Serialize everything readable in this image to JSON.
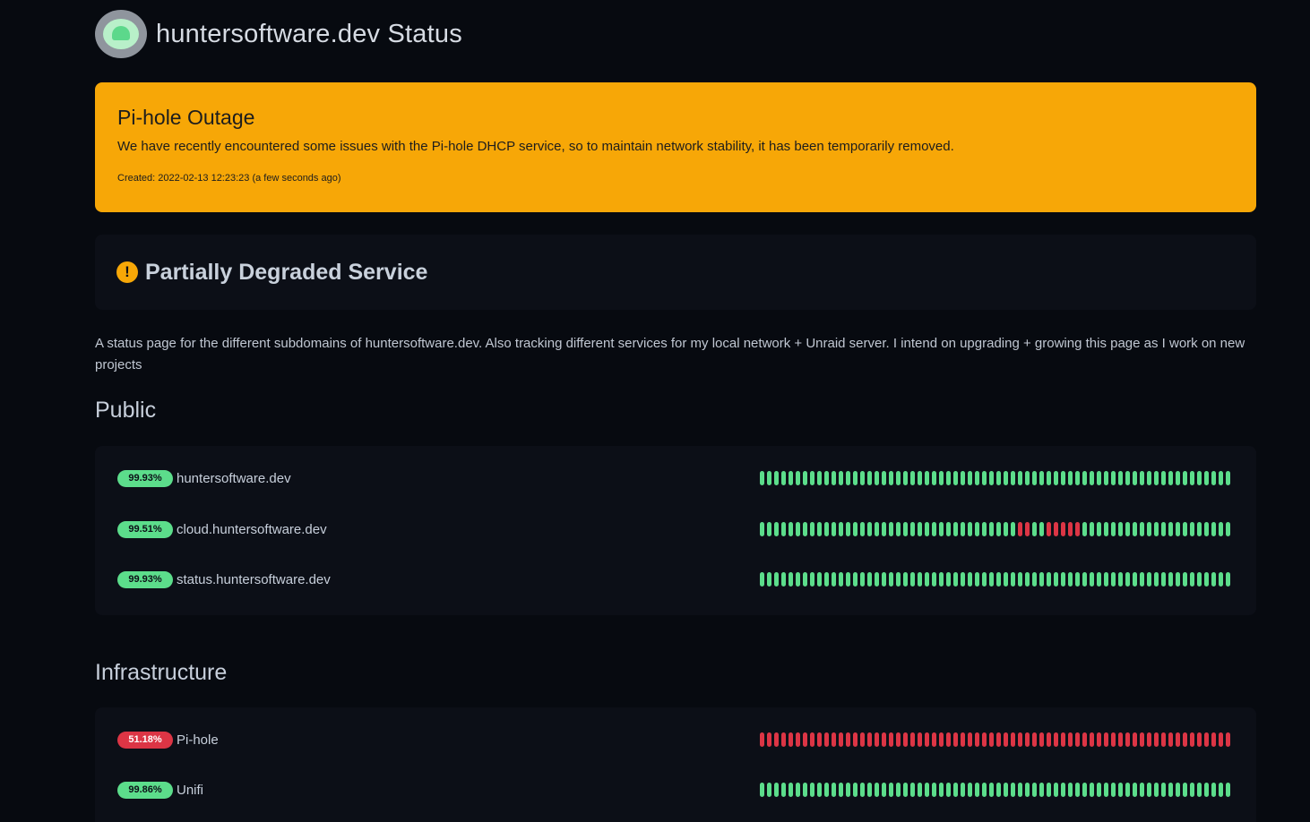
{
  "header": {
    "title": "huntersoftware.dev Status",
    "logo_icon": "status-logo-icon"
  },
  "incident": {
    "title": "Pi-hole Outage",
    "body": "We have recently encountered some issues with the Pi-hole DHCP service, so to maintain network stability, it has been temporarily removed.",
    "created": "Created: 2022-02-13 12:23:23 (a few seconds ago)",
    "color": "#f7a707"
  },
  "overall": {
    "icon": "exclamation-circle-icon",
    "text": "Partially Degraded Service"
  },
  "description": "A status page for the different subdomains of huntersoftware.dev.  Also tracking different services for my local network + Unraid server.  I intend on upgrading + growing this page as I work on new projects",
  "colors": {
    "up": "#5cdd8b",
    "down": "#dc3545",
    "background": "#070a10",
    "card": "#0c0f17"
  },
  "groups": [
    {
      "name": "Public",
      "monitors": [
        {
          "uptime": "99.93%",
          "status": "up",
          "name": "huntersoftware.dev",
          "beats": "111111111111111111111111111111111111111111111111111111111111111111"
        },
        {
          "uptime": "99.51%",
          "status": "up",
          "name": "cloud.huntersoftware.dev",
          "beats": "111111111111111111111111111111111111001100000111111111111111111111"
        },
        {
          "uptime": "99.93%",
          "status": "up",
          "name": "status.huntersoftware.dev",
          "beats": "111111111111111111111111111111111111111111111111111111111111111111"
        }
      ]
    },
    {
      "name": "Infrastructure",
      "monitors": [
        {
          "uptime": "51.18%",
          "status": "down",
          "name": "Pi-hole",
          "beats": "000000000000000000000000000000000000000000000000000000000000000000"
        },
        {
          "uptime": "99.86%",
          "status": "up",
          "name": "Unifi",
          "beats": "111111111111111111111111111111111111111111111111111111111111111111"
        }
      ]
    }
  ]
}
